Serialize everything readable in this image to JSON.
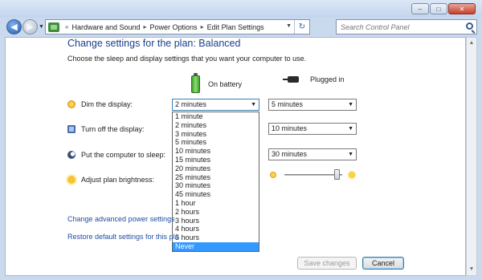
{
  "window": {
    "minimize_label": "–",
    "maximize_label": "□",
    "close_label": "✕"
  },
  "nav": {
    "breadcrumbs": [
      "Hardware and Sound",
      "Power Options",
      "Edit Plan Settings"
    ],
    "separator": "▸",
    "prefix": "«",
    "search_placeholder": "Search Control Panel"
  },
  "page": {
    "title": "Change settings for the plan: Balanced",
    "subtitle": "Choose the sleep and display settings that you want your computer to use.",
    "on_battery_label": "On battery",
    "plugged_in_label": "Plugged in"
  },
  "settings": {
    "dim_label": "Dim the display:",
    "dim_battery": "2 minutes",
    "dim_plugged": "5 minutes",
    "turn_off_label": "Turn off the display:",
    "turn_off_plugged": "10 minutes",
    "sleep_label": "Put the computer to sleep:",
    "sleep_plugged": "30 minutes",
    "brightness_label": "Adjust plan brightness:",
    "brightness_plugged_level": 0.9
  },
  "dropdown": {
    "options": [
      "1 minute",
      "2 minutes",
      "3 minutes",
      "5 minutes",
      "10 minutes",
      "15 minutes",
      "20 minutes",
      "25 minutes",
      "30 minutes",
      "45 minutes",
      "1 hour",
      "2 hours",
      "3 hours",
      "4 hours",
      "5 hours",
      "Never"
    ],
    "highlighted": "Never"
  },
  "links": {
    "advanced": "Change advanced power settings",
    "restore": "Restore default settings for this pla"
  },
  "buttons": {
    "save": "Save changes",
    "cancel": "Cancel"
  }
}
